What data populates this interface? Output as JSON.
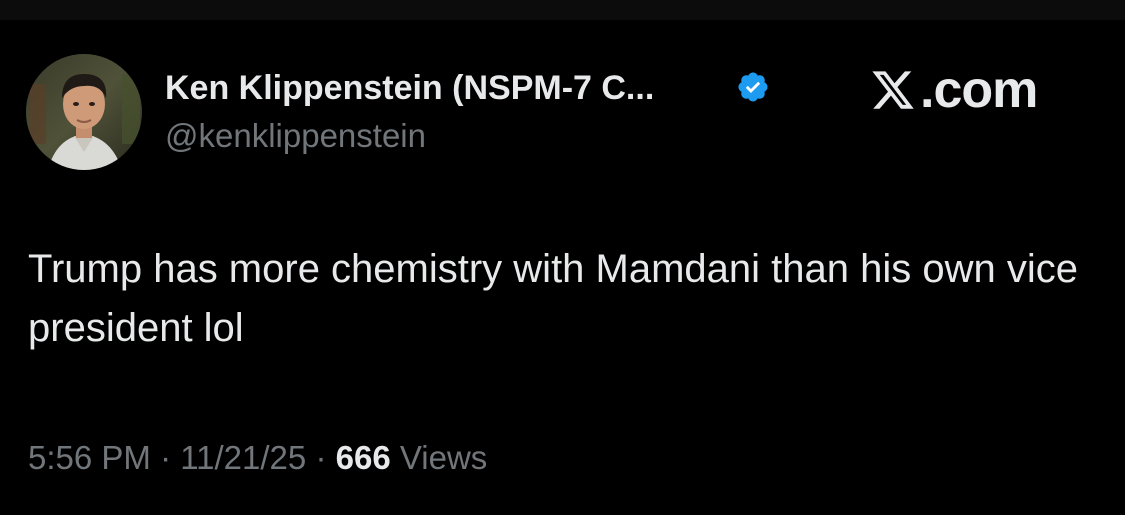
{
  "author": {
    "display_name": "Ken Klippenstein (NSPM-7 C...",
    "handle": "@kenklippenstein",
    "verified": true,
    "verified_color": "#1d9bf0"
  },
  "brand": {
    "text": ".com",
    "icon": "x-logo-icon"
  },
  "tweet": {
    "text": "Trump has more chemistry with Mamdani than his own vice president lol"
  },
  "meta": {
    "time": "5:56 PM",
    "separator": "·",
    "date": "11/21/25",
    "views_count": "666",
    "views_label": "Views"
  },
  "colors": {
    "background": "#000000",
    "primary_text": "#e7e9ea",
    "secondary_text": "#71767b"
  }
}
